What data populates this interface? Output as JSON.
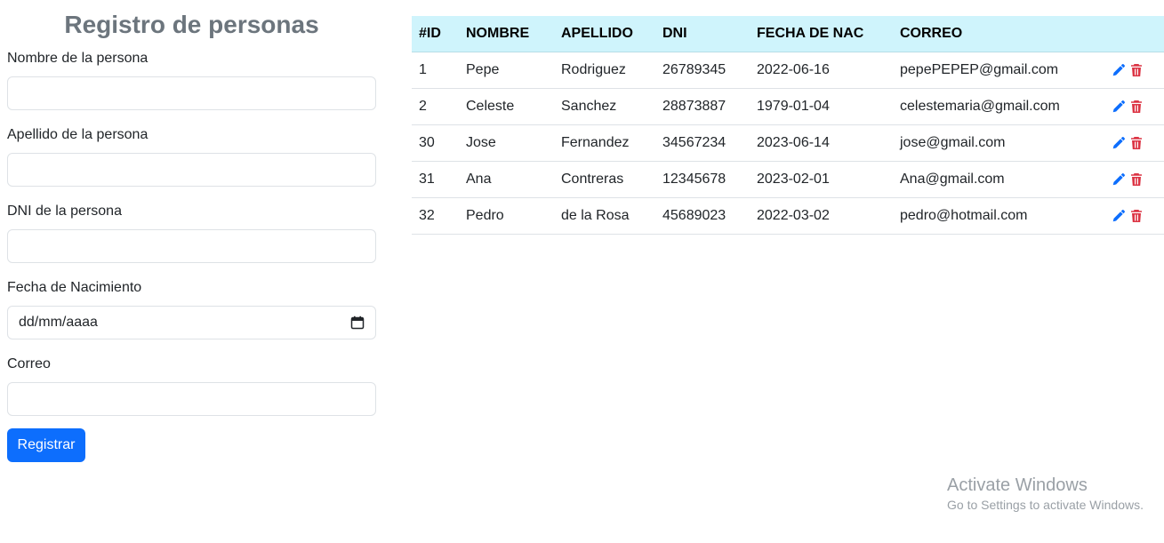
{
  "form": {
    "title": "Registro de personas",
    "fields": [
      {
        "label": "Nombre de la persona",
        "value": ""
      },
      {
        "label": "Apellido de la persona",
        "value": ""
      },
      {
        "label": "DNI de la persona",
        "value": ""
      },
      {
        "label": "Fecha de Nacimiento",
        "value": "dd/mm/aaaa"
      },
      {
        "label": "Correo",
        "value": ""
      }
    ],
    "submit_label": "Registrar"
  },
  "table": {
    "headers": [
      "#ID",
      "NOMBRE",
      "APELLIDO",
      "DNI",
      "FECHA DE NAC",
      "CORREO"
    ],
    "rows": [
      {
        "id": "1",
        "nombre": "Pepe",
        "apellido": "Rodriguez",
        "dni": "26789345",
        "fecha": "2022-06-16",
        "correo": "pepePEPEP@gmail.com"
      },
      {
        "id": "2",
        "nombre": "Celeste",
        "apellido": "Sanchez",
        "dni": "28873887",
        "fecha": "1979-01-04",
        "correo": "celestemaria@gmail.com"
      },
      {
        "id": "30",
        "nombre": "Jose",
        "apellido": "Fernandez",
        "dni": "34567234",
        "fecha": "2023-06-14",
        "correo": "jose@gmail.com"
      },
      {
        "id": "31",
        "nombre": "Ana",
        "apellido": "Contreras",
        "dni": "12345678",
        "fecha": "2023-02-01",
        "correo": "Ana@gmail.com"
      },
      {
        "id": "32",
        "nombre": "Pedro",
        "apellido": "de la Rosa",
        "dni": "45689023",
        "fecha": "2022-03-02",
        "correo": "pedro@hotmail.com"
      }
    ],
    "edit_icon": "pencil-icon",
    "delete_icon": "trash-icon"
  },
  "colors": {
    "title": "#6c757d",
    "header_bg": "#cff4fc",
    "button_bg": "#0d6efd",
    "edit_icon": "#0d6efd",
    "delete_icon": "#dc3545"
  },
  "watermark": {
    "title": "Activate Windows",
    "subtitle": "Go to Settings to activate Windows."
  }
}
